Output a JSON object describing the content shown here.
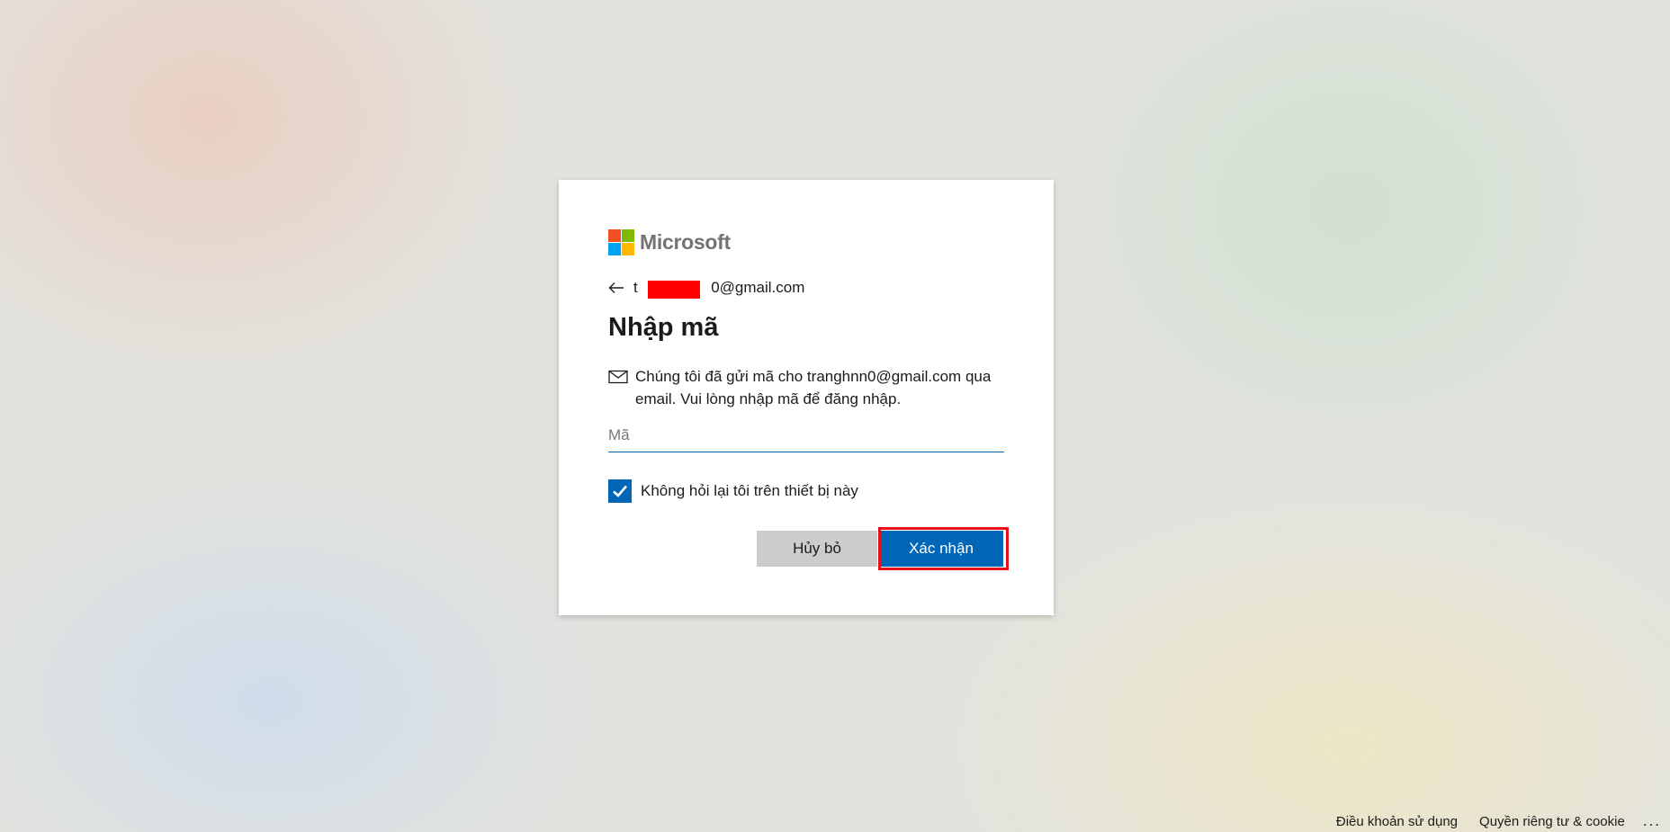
{
  "brand": {
    "name": "Microsoft",
    "colors": {
      "red": "#f25022",
      "green": "#7fba00",
      "blue": "#00a4ef",
      "yellow": "#ffb900"
    }
  },
  "identity": {
    "email": "0@gmail.com",
    "back_icon": "arrow-left-icon"
  },
  "title": "Nhập mã",
  "description": {
    "icon": "mail-icon",
    "text": "Chúng tôi đã gửi mã cho tranghnn0@gmail.com qua email. Vui lòng nhập mã để đăng nhập."
  },
  "code_input": {
    "placeholder": "Mã",
    "value": ""
  },
  "keep_signed": {
    "label": "Không hỏi lại tôi trên thiết bị này",
    "checked": true
  },
  "buttons": {
    "cancel": "Hủy bỏ",
    "confirm": "Xác nhận"
  },
  "accent_color": "#0067b8",
  "footer": {
    "terms": "Điều khoản sử dụng",
    "privacy": "Quyền riêng tư & cookie",
    "more": "..."
  }
}
